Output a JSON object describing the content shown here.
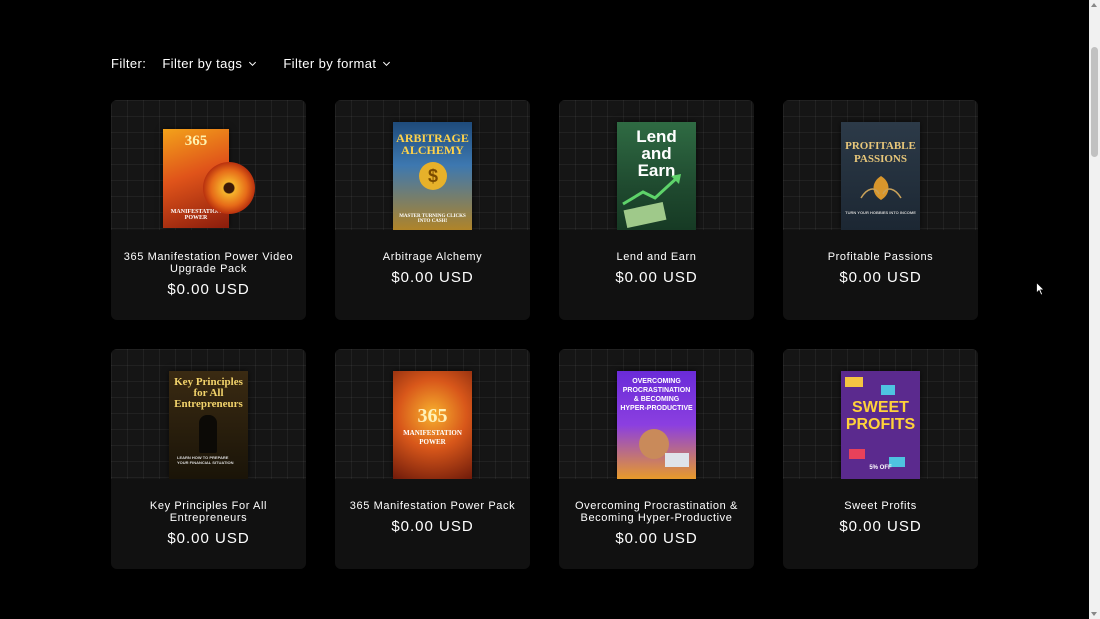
{
  "filter": {
    "label": "Filter:",
    "tags_label": "Filter by tags",
    "format_label": "Filter by format"
  },
  "products": [
    {
      "title": "365 Manifestation Power Video Upgrade Pack",
      "price": "$0.00 USD",
      "cover_text": "365",
      "cover_subtext": "MANIFESTATION POWER"
    },
    {
      "title": "Arbitrage Alchemy",
      "price": "$0.00 USD",
      "cover_text": "ARBITRAGE ALCHEMY",
      "cover_subtext": "MASTER TURNING CLICKS INTO CASH!"
    },
    {
      "title": "Lend and Earn",
      "price": "$0.00 USD",
      "cover_text": "Lend and Earn",
      "cover_subtext": ""
    },
    {
      "title": "Profitable Passions",
      "price": "$0.00 USD",
      "cover_text": "PROFITABLE PASSIONS",
      "cover_subtext": "TURN YOUR HOBBIES INTO INCOME"
    },
    {
      "title": "Key Principles For All Entrepreneurs",
      "price": "$0.00 USD",
      "cover_text": "Key Principles for All Entrepreneurs",
      "cover_subtext": "LEARN HOW TO PREPARE YOUR FINANCIAL SITUATION"
    },
    {
      "title": "365 Manifestation Power Pack",
      "price": "$0.00 USD",
      "cover_text": "365",
      "cover_subtext": "MANIFESTATION POWER"
    },
    {
      "title": "Overcoming Procrastination & Becoming Hyper-Productive",
      "price": "$0.00 USD",
      "cover_text": "OVERCOMING PROCRASTINATION & BECOMING HYPER-PRODUCTIVE",
      "cover_subtext": ""
    },
    {
      "title": "Sweet Profits",
      "price": "$0.00 USD",
      "cover_text": "SWEET PROFITS",
      "cover_subtext": "5% OFF"
    }
  ],
  "icons": {
    "filter_chevron": "chevron-down-icon",
    "cursor": "mouse-pointer-icon"
  }
}
